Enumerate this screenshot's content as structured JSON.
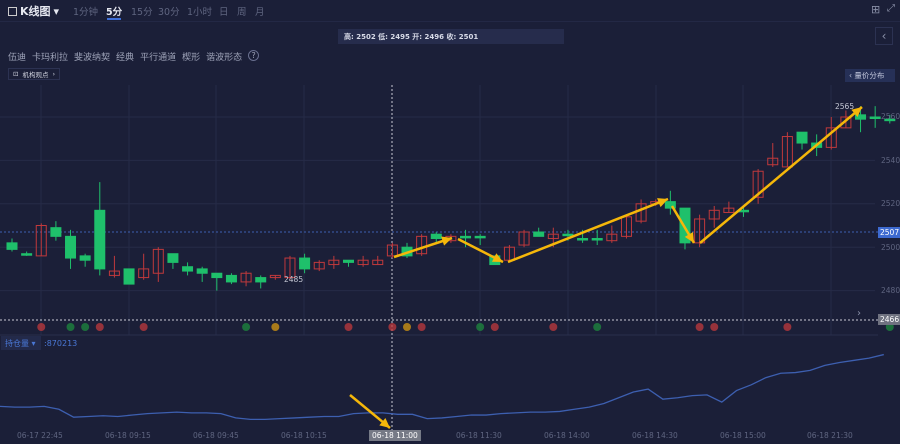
{
  "toolbar": {
    "chart_type": "K线图",
    "periods": [
      "1分钟",
      "5分",
      "15分",
      "30分",
      "1小时",
      "日",
      "周",
      "月"
    ],
    "active_period": "5分"
  },
  "ohlc_tooltip": "高: 2502 低: 2495 开: 2496 收: 2501",
  "drawing_tools": [
    "伍迪",
    "卡玛利拉",
    "斐波纳契",
    "经典",
    "平行通道",
    "楔形",
    "谐波形态"
  ],
  "help_icon": "?",
  "view_button": "机构观点",
  "volume_profile_button": "量价分布",
  "indicator": {
    "name": "持仓量",
    "value": "870213"
  },
  "x_labels": [
    "06-17 22:45",
    "06-18 09:15",
    "06-18 09:45",
    "06-18 10:15",
    "06-18 11:30",
    "06-18 14:00",
    "06-18 14:30",
    "06-18 15:00",
    "06-18 21:30"
  ],
  "crosshair_label": "06-18 11:00",
  "y_labels": [
    "2560",
    "2540",
    "2520",
    "2500",
    "2480"
  ],
  "current_price": "2507",
  "line_price": "2466",
  "high_marker": "2565",
  "low_marker": "2485",
  "colors": {
    "up": "#c0393c",
    "down": "#1fc06b",
    "arrow": "#f5b70a",
    "oi_line": "#3d5fb0"
  },
  "chart_data": {
    "type": "candlestick",
    "ylim": [
      2466,
      2570
    ],
    "candles": [
      [
        2502,
        2504,
        2498,
        2499
      ],
      [
        2497,
        2498,
        2496,
        2497
      ],
      [
        2496,
        2511,
        2496,
        2510
      ],
      [
        2509,
        2512,
        2503,
        2505
      ],
      [
        2505,
        2508,
        2490,
        2495
      ],
      [
        2496,
        2497,
        2491,
        2494
      ],
      [
        2517,
        2530,
        2487,
        2490
      ],
      [
        2487,
        2496,
        2486,
        2489
      ],
      [
        2490,
        2490,
        2483,
        2483
      ],
      [
        2486,
        2497,
        2485,
        2490
      ],
      [
        2488,
        2500,
        2484,
        2499
      ],
      [
        2497,
        2497,
        2490,
        2493
      ],
      [
        2491,
        2493,
        2487,
        2489
      ],
      [
        2490,
        2491,
        2484,
        2488
      ],
      [
        2488,
        2488,
        2480,
        2486
      ],
      [
        2487,
        2488,
        2483,
        2484
      ],
      [
        2484,
        2489,
        2482,
        2488
      ],
      [
        2486,
        2487,
        2481,
        2484
      ],
      [
        2486,
        2487,
        2485,
        2487
      ],
      [
        2486,
        2496,
        2485,
        2495
      ],
      [
        2495,
        2497,
        2488,
        2490
      ],
      [
        2490,
        2494,
        2489,
        2493
      ],
      [
        2492,
        2496,
        2490,
        2494
      ],
      [
        2494,
        2494,
        2491,
        2493
      ],
      [
        2492,
        2496,
        2491,
        2494
      ],
      [
        2492,
        2496,
        2492,
        2494
      ],
      [
        2496,
        2502,
        2495,
        2501
      ],
      [
        2500,
        2502,
        2495,
        2496
      ],
      [
        2497,
        2506,
        2496,
        2505
      ],
      [
        2506,
        2507,
        2502,
        2504
      ],
      [
        2503,
        2506,
        2502,
        2505
      ],
      [
        2505,
        2508,
        2500,
        2505
      ],
      [
        2505,
        2506,
        2501,
        2505
      ],
      [
        2496,
        2496,
        2492,
        2492
      ],
      [
        2494,
        2501,
        2493,
        2500
      ],
      [
        2501,
        2508,
        2500,
        2507
      ],
      [
        2507,
        2509,
        2505,
        2505
      ],
      [
        2504,
        2509,
        2500,
        2506
      ],
      [
        2506,
        2508,
        2503,
        2506
      ],
      [
        2504,
        2508,
        2502,
        2504
      ],
      [
        2504,
        2508,
        2501,
        2504
      ],
      [
        2503,
        2510,
        2502,
        2506
      ],
      [
        2505,
        2515,
        2504,
        2514
      ],
      [
        2512,
        2522,
        2511,
        2520
      ],
      [
        2520,
        2522,
        2519,
        2521
      ],
      [
        2521,
        2526,
        2515,
        2518
      ],
      [
        2518,
        2518,
        2499,
        2502
      ],
      [
        2502,
        2515,
        2500,
        2513
      ],
      [
        2513,
        2519,
        2509,
        2517
      ],
      [
        2516,
        2521,
        2516,
        2518
      ],
      [
        2517,
        2519,
        2514,
        2517
      ],
      [
        2523,
        2536,
        2520,
        2535
      ],
      [
        2538,
        2548,
        2537,
        2541
      ],
      [
        2537,
        2553,
        2537,
        2551
      ],
      [
        2553,
        2553,
        2545,
        2548
      ],
      [
        2548,
        2552,
        2542,
        2546
      ],
      [
        2546,
        2560,
        2545,
        2555
      ],
      [
        2555,
        2563,
        2555,
        2560
      ],
      [
        2561,
        2565,
        2553,
        2559
      ],
      [
        2560,
        2565,
        2555,
        2560
      ],
      [
        2559,
        2561,
        2557,
        2559
      ]
    ],
    "open_interest": [
      30,
      29,
      29,
      30,
      26,
      15,
      16,
      17,
      16,
      18,
      20,
      21,
      22,
      21,
      21,
      20,
      14,
      12,
      12,
      13,
      14,
      15,
      16,
      16,
      20,
      21,
      21,
      19,
      19,
      13,
      14,
      16,
      18,
      18,
      20,
      21,
      22,
      22,
      23,
      26,
      29,
      34,
      42,
      50,
      54,
      40,
      42,
      45,
      46,
      36,
      52,
      60,
      70,
      76,
      77,
      80,
      87,
      91,
      94,
      97,
      102
    ]
  },
  "markers": [
    {
      "i": 2,
      "t": "up"
    },
    {
      "i": 4,
      "t": "down"
    },
    {
      "i": 5,
      "t": "down"
    },
    {
      "i": 6,
      "t": "up"
    },
    {
      "i": 9,
      "t": "up"
    },
    {
      "i": 16,
      "t": "down"
    },
    {
      "i": 18,
      "t": "warn"
    },
    {
      "i": 23,
      "t": "up"
    },
    {
      "i": 26,
      "t": "up"
    },
    {
      "i": 27,
      "t": "warn"
    },
    {
      "i": 28,
      "t": "up"
    },
    {
      "i": 32,
      "t": "down"
    },
    {
      "i": 33,
      "t": "up"
    },
    {
      "i": 37,
      "t": "up"
    },
    {
      "i": 40,
      "t": "down"
    },
    {
      "i": 47,
      "t": "up"
    },
    {
      "i": 48,
      "t": "up"
    },
    {
      "i": 53,
      "t": "up"
    },
    {
      "i": 60,
      "t": "down"
    }
  ]
}
